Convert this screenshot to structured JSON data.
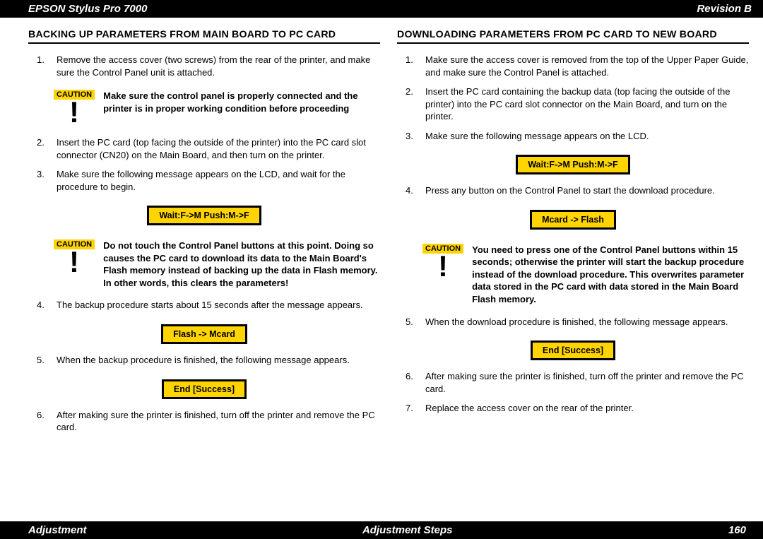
{
  "header": {
    "left": "EPSON Stylus Pro 7000",
    "right": "Revision B"
  },
  "footer": {
    "left": "Adjustment",
    "center": "Adjustment Steps",
    "right": "160"
  },
  "left": {
    "title": "BACKING UP PARAMETERS FROM MAIN BOARD TO PC CARD",
    "step1_num": "1.",
    "step1": "Remove the access cover (two screws) from the rear of the printer, and make sure the Control Panel unit is attached.",
    "caution1_label": "CAUTION",
    "caution1": "Make sure the control panel is properly connected and the printer is in proper working condition before proceeding",
    "step2_num": "2.",
    "step2": "Insert the PC card (top facing the outside of the printer) into the PC card slot connector (CN20) on the Main Board, and then turn on the printer.",
    "step3_num": "3.",
    "step3": "Make sure the following message appears on the LCD, and wait for the procedure to begin.",
    "lcd1": "Wait:F->M Push:M->F",
    "caution2_label": "CAUTION",
    "caution2": "Do not touch the Control Panel buttons at this point. Doing so causes the PC card to download its data to the Main Board's Flash memory instead of backing up the data in Flash memory. In other words, this clears the parameters!",
    "step4_num": "4.",
    "step4": "The backup procedure starts about 15 seconds after the message appears.",
    "lcd2": "Flash -> Mcard",
    "step5_num": "5.",
    "step5": "When the backup procedure is finished, the following message appears.",
    "lcd3": "End [Success]",
    "step6_num": "6.",
    "step6": "After making sure the printer is finished, turn off the printer and remove the PC card."
  },
  "right": {
    "title": "DOWNLOADING PARAMETERS FROM PC CARD TO NEW BOARD",
    "step1_num": "1.",
    "step1": "Make sure the access cover is removed from the top of the Upper Paper Guide, and make sure the Control Panel is attached.",
    "step2_num": "2.",
    "step2": "Insert the PC card containing the backup data (top facing the outside of the printer) into the PC card slot connector on the Main Board, and turn on the printer.",
    "step3_num": "3.",
    "step3": "Make sure the following message appears on the LCD.",
    "lcd1": "Wait:F->M Push:M->F",
    "step4_num": "4.",
    "step4": "Press any button on the Control Panel to start the download procedure.",
    "lcd2": "Mcard -> Flash",
    "caution_label": "CAUTION",
    "caution": "You need to press one of the Control Panel buttons within 15 seconds; otherwise the printer will start the backup procedure instead of the download procedure. This overwrites parameter data stored in the PC card with data stored in the Main Board Flash memory.",
    "step5_num": "5.",
    "step5": "When the download procedure is finished, the following message appears.",
    "lcd3": "End [Success]",
    "step6_num": "6.",
    "step6": "After making sure the printer is finished, turn off the printer and remove the PC card.",
    "step7_num": "7.",
    "step7": "Replace the access cover on the rear of the printer."
  }
}
